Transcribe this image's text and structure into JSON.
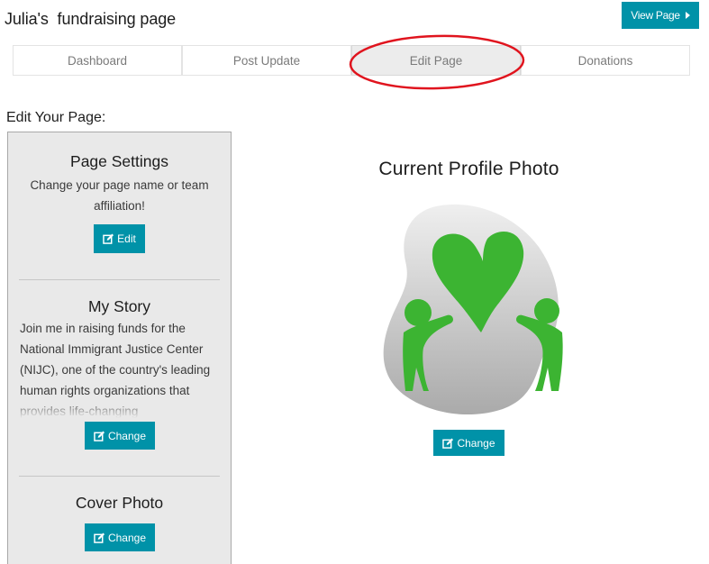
{
  "header": {
    "title": "Julia's  fundraising page",
    "view_page_label": "View Page"
  },
  "tabs": [
    {
      "label": "Dashboard",
      "active": false
    },
    {
      "label": "Post Update",
      "active": false
    },
    {
      "label": "Edit Page",
      "active": true
    },
    {
      "label": "Donations",
      "active": false
    }
  ],
  "colors": {
    "accent": "#0092a8",
    "annotation": "#e0141e",
    "logo_green": "#3cb432"
  },
  "edit_heading": "Edit Your Page:",
  "sidebar": {
    "page_settings": {
      "title": "Page Settings",
      "description": "Change your page name or team affiliation!",
      "button_label": "Edit"
    },
    "my_story": {
      "title": "My Story",
      "text": "Join me in raising funds for the National Immigrant Justice Center (NIJC), one of the country's leading human rights organizations that provides life-changing",
      "button_label": "Change"
    },
    "cover_photo": {
      "title": "Cover Photo",
      "button_label": "Change"
    }
  },
  "profile": {
    "title": "Current Profile Photo",
    "image_alt": "heart-with-two-people-logo",
    "button_label": "Change"
  }
}
